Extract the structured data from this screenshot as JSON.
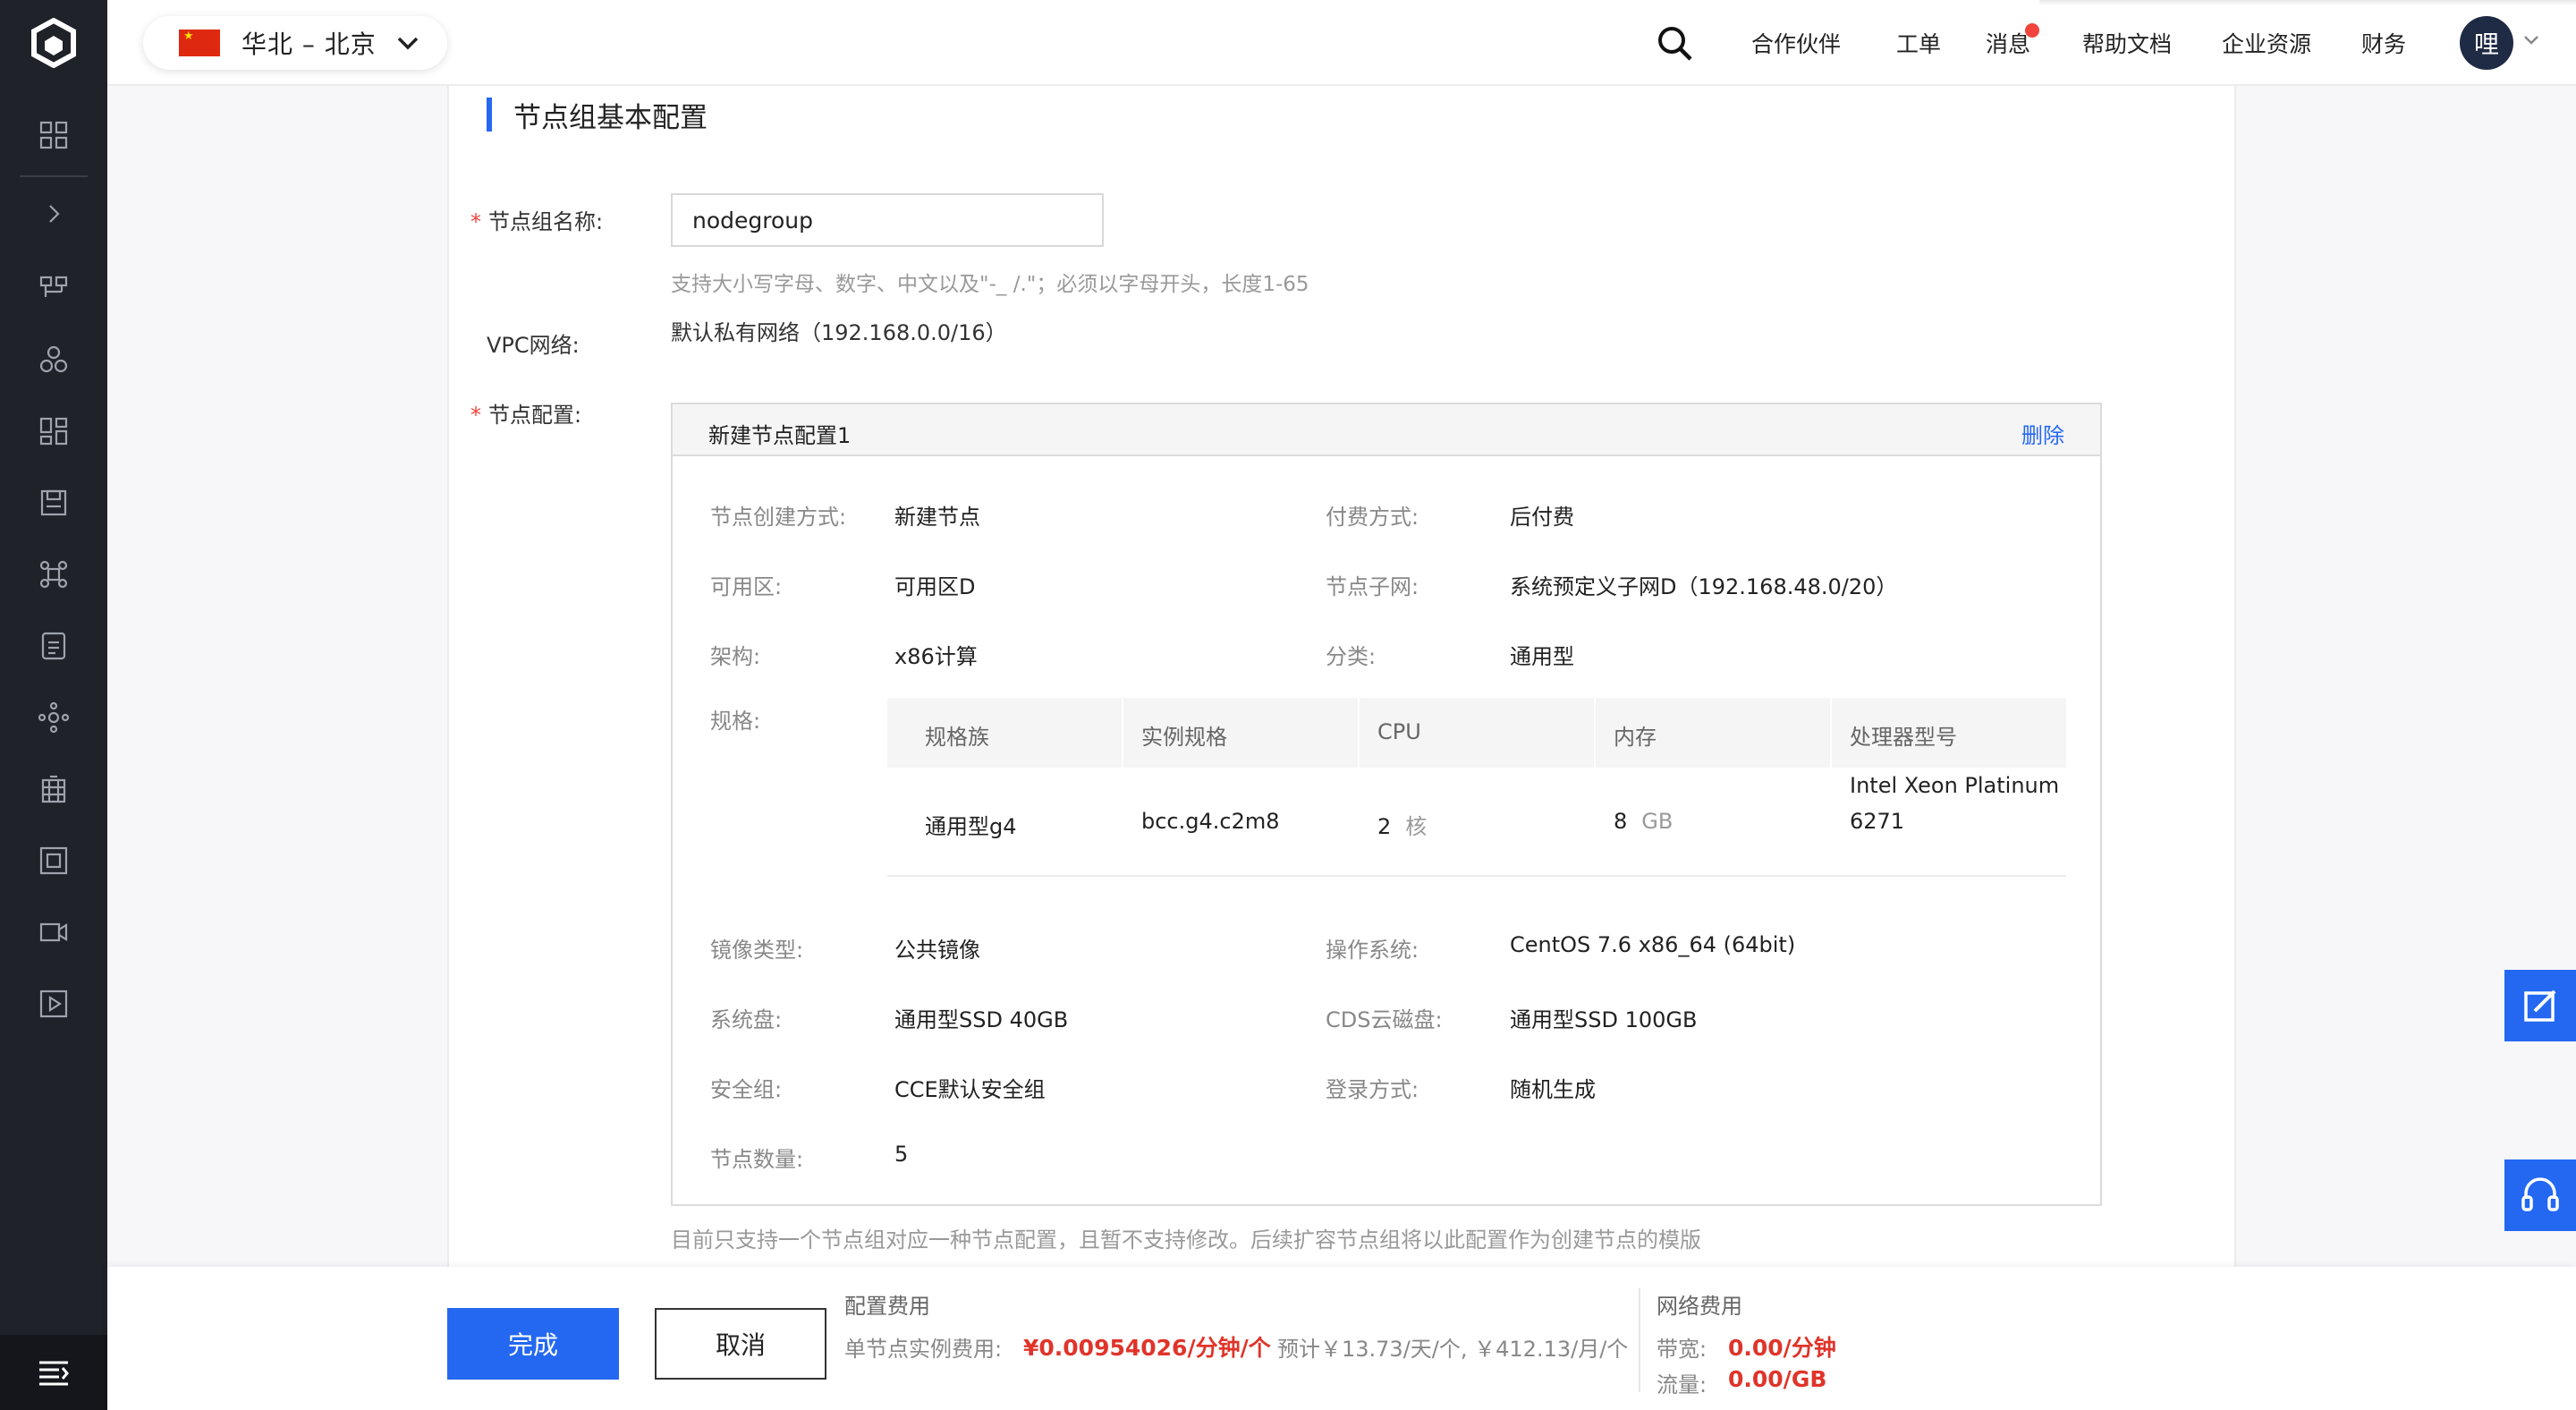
{
  "topbar": {
    "region_label": "华北 – 北京",
    "nav": [
      "合作伙伴",
      "工单",
      "消息",
      "帮助文档",
      "企业资源",
      "财务"
    ],
    "avatar_text": "哩"
  },
  "section": {
    "title": "节点组基本配置"
  },
  "form": {
    "name_label": "节点组名称:",
    "name_value": "nodegroup",
    "name_hint": "支持大小写字母、数字、中文以及\"-_ /.\"；必须以字母开头，长度1-65",
    "vpc_label": "VPC网络:",
    "vpc_value": "默认私有网络（192.168.0.0/16）",
    "node_cfg_label": "节点配置:"
  },
  "node_config": {
    "title": "新建节点配置1",
    "delete_label": "删除",
    "create_mode_k": "节点创建方式:",
    "create_mode_v": "新建节点",
    "pay_k": "付费方式:",
    "pay_v": "后付费",
    "zone_k": "可用区:",
    "zone_v": "可用区D",
    "subnet_k": "节点子网:",
    "subnet_v": "系统预定义子网D（192.168.48.0/20）",
    "arch_k": "架构:",
    "arch_v": "x86计算",
    "class_k": "分类:",
    "class_v": "通用型",
    "spec_k": "规格:",
    "spec_headers": [
      "规格族",
      "实例规格",
      "CPU",
      "内存",
      "处理器型号"
    ],
    "spec_row": {
      "family": "通用型g4",
      "instance": "bcc.g4.c2m8",
      "cpu": "2",
      "cpu_unit": "核",
      "mem": "8",
      "mem_unit": "GB",
      "cpu_model_line1": "Intel Xeon Platinum",
      "cpu_model_line2": "6271"
    },
    "image_k": "镜像类型:",
    "image_v": "公共镜像",
    "os_k": "操作系统:",
    "os_v": "CentOS 7.6 x86_64 (64bit)",
    "sysdisk_k": "系统盘:",
    "sysdisk_v": "通用型SSD 40GB",
    "cds_k": "CDS云磁盘:",
    "cds_v": "通用型SSD 100GB",
    "secgroup_k": "安全组:",
    "secgroup_v": "CCE默认安全组",
    "login_k": "登录方式:",
    "login_v": "随机生成",
    "count_k": "节点数量:",
    "count_v": "5"
  },
  "note": "目前只支持一个节点组对应一种节点配置，且暂不支持修改。后续扩容节点组将以此配置作为创建节点的模版",
  "footer": {
    "finish_label": "完成",
    "cancel_label": "取消",
    "config_fee_title": "配置费用",
    "unit_price_k": "单节点实例费用:",
    "unit_price_v": "¥0.00954026/分钟/个",
    "estimate": "预计￥13.73/天/个, ￥412.13/月/个",
    "net_fee_title": "网络费用",
    "bandwidth_k": "带宽:",
    "bandwidth_v": "0.00/分钟",
    "traffic_k": "流量:",
    "traffic_v": "0.00/GB"
  }
}
